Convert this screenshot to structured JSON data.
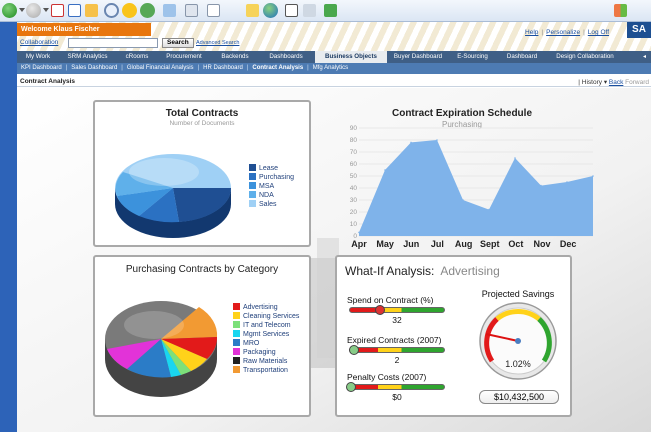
{
  "portal": {
    "welcome": "Welcome Klaus Fischer",
    "collaboration": "Collaboration",
    "search_button": "Search",
    "advanced_search": "Advanced Search",
    "help": "Help",
    "personalize": "Personalize",
    "log_off": "Log Off",
    "logo": "SA"
  },
  "nav": {
    "tabs": [
      "My Work",
      "SRM Analytics",
      "cRooms",
      "Procurement",
      "Backends",
      "Dashboards",
      "Business Objects",
      "Buyer Dashboard",
      "E-Sourcing",
      "Dashboard",
      "Design Collaboration"
    ],
    "active_tab": "Business Objects",
    "subtabs": [
      "KPI Dashboard",
      "Sales Dashboard",
      "Global Financial Analysis",
      "HR Dashboard",
      "Contract Analysis",
      "Mfg Analytics"
    ],
    "active_subtab": "Contract Analysis"
  },
  "page": {
    "title": "Contract Analysis",
    "history": "History",
    "back": "Back",
    "forward": "Forward"
  },
  "colors": {
    "nav_dark": "#3f5f86",
    "nav_sub": "#4d7bb3",
    "welcome_orange": "#e8760e",
    "area_fill": "#7fb3ea"
  },
  "total_contracts": {
    "title": "Total Contracts",
    "subtitle": "Number of Documents",
    "legend": [
      {
        "name": "Lease",
        "color": "#1f4f93"
      },
      {
        "name": "Purchasing",
        "color": "#2b71c2"
      },
      {
        "name": "MSA",
        "color": "#3c92dc"
      },
      {
        "name": "NDA",
        "color": "#5fb0ea"
      },
      {
        "name": "Sales",
        "color": "#9fd0f5"
      }
    ]
  },
  "purchasing_category": {
    "title": "Purchasing Contracts by Category",
    "legend": [
      {
        "name": "Advertising",
        "color": "#e21a1a"
      },
      {
        "name": "Cleaning Services",
        "color": "#ffd21a"
      },
      {
        "name": "IT and Telecom",
        "color": "#7ce07a"
      },
      {
        "name": "Mgmt Services",
        "color": "#19d6f0"
      },
      {
        "name": "MRO",
        "color": "#2b7cc7"
      },
      {
        "name": "Packaging",
        "color": "#e233d8"
      },
      {
        "name": "Raw Materials",
        "color": "#222222"
      },
      {
        "name": "Transportation",
        "color": "#f29a33"
      }
    ]
  },
  "chart_data": {
    "type": "area",
    "title": "Contract Expiration Schedule",
    "subtitle": "Purchasing",
    "categories": [
      "Apr",
      "May",
      "Jun",
      "Jul",
      "Aug",
      "Sept",
      "Oct",
      "Nov",
      "Dec"
    ],
    "x_tick_labels": [
      "Apr",
      "May",
      "Jun",
      "Jul",
      "Aug",
      "Sept",
      "Oct",
      "Nov",
      "Dec"
    ],
    "series": [
      {
        "values": [
          3,
          55,
          78,
          80,
          30,
          22,
          65,
          42,
          45,
          50
        ]
      }
    ],
    "y_ticks": [
      0,
      10,
      20,
      30,
      40,
      50,
      60,
      70,
      80,
      90
    ],
    "ylim": [
      0,
      90
    ],
    "grid": true
  },
  "what_if": {
    "title": "What-If Analysis:",
    "title_accent": "Advertising",
    "sliders": [
      {
        "label": "Spend on Contract (%)",
        "value": "32",
        "position": 0.32
      },
      {
        "label": "Expired Contracts (2007)",
        "value": "2",
        "position": 0.05
      },
      {
        "label": "Penalty Costs (2007)",
        "value": "$0",
        "position": 0.02
      }
    ],
    "gauge": {
      "title": "Projected Savings",
      "percent_label": "1.02%",
      "percent_value": 1.02,
      "savings": "$10,432,500"
    }
  }
}
